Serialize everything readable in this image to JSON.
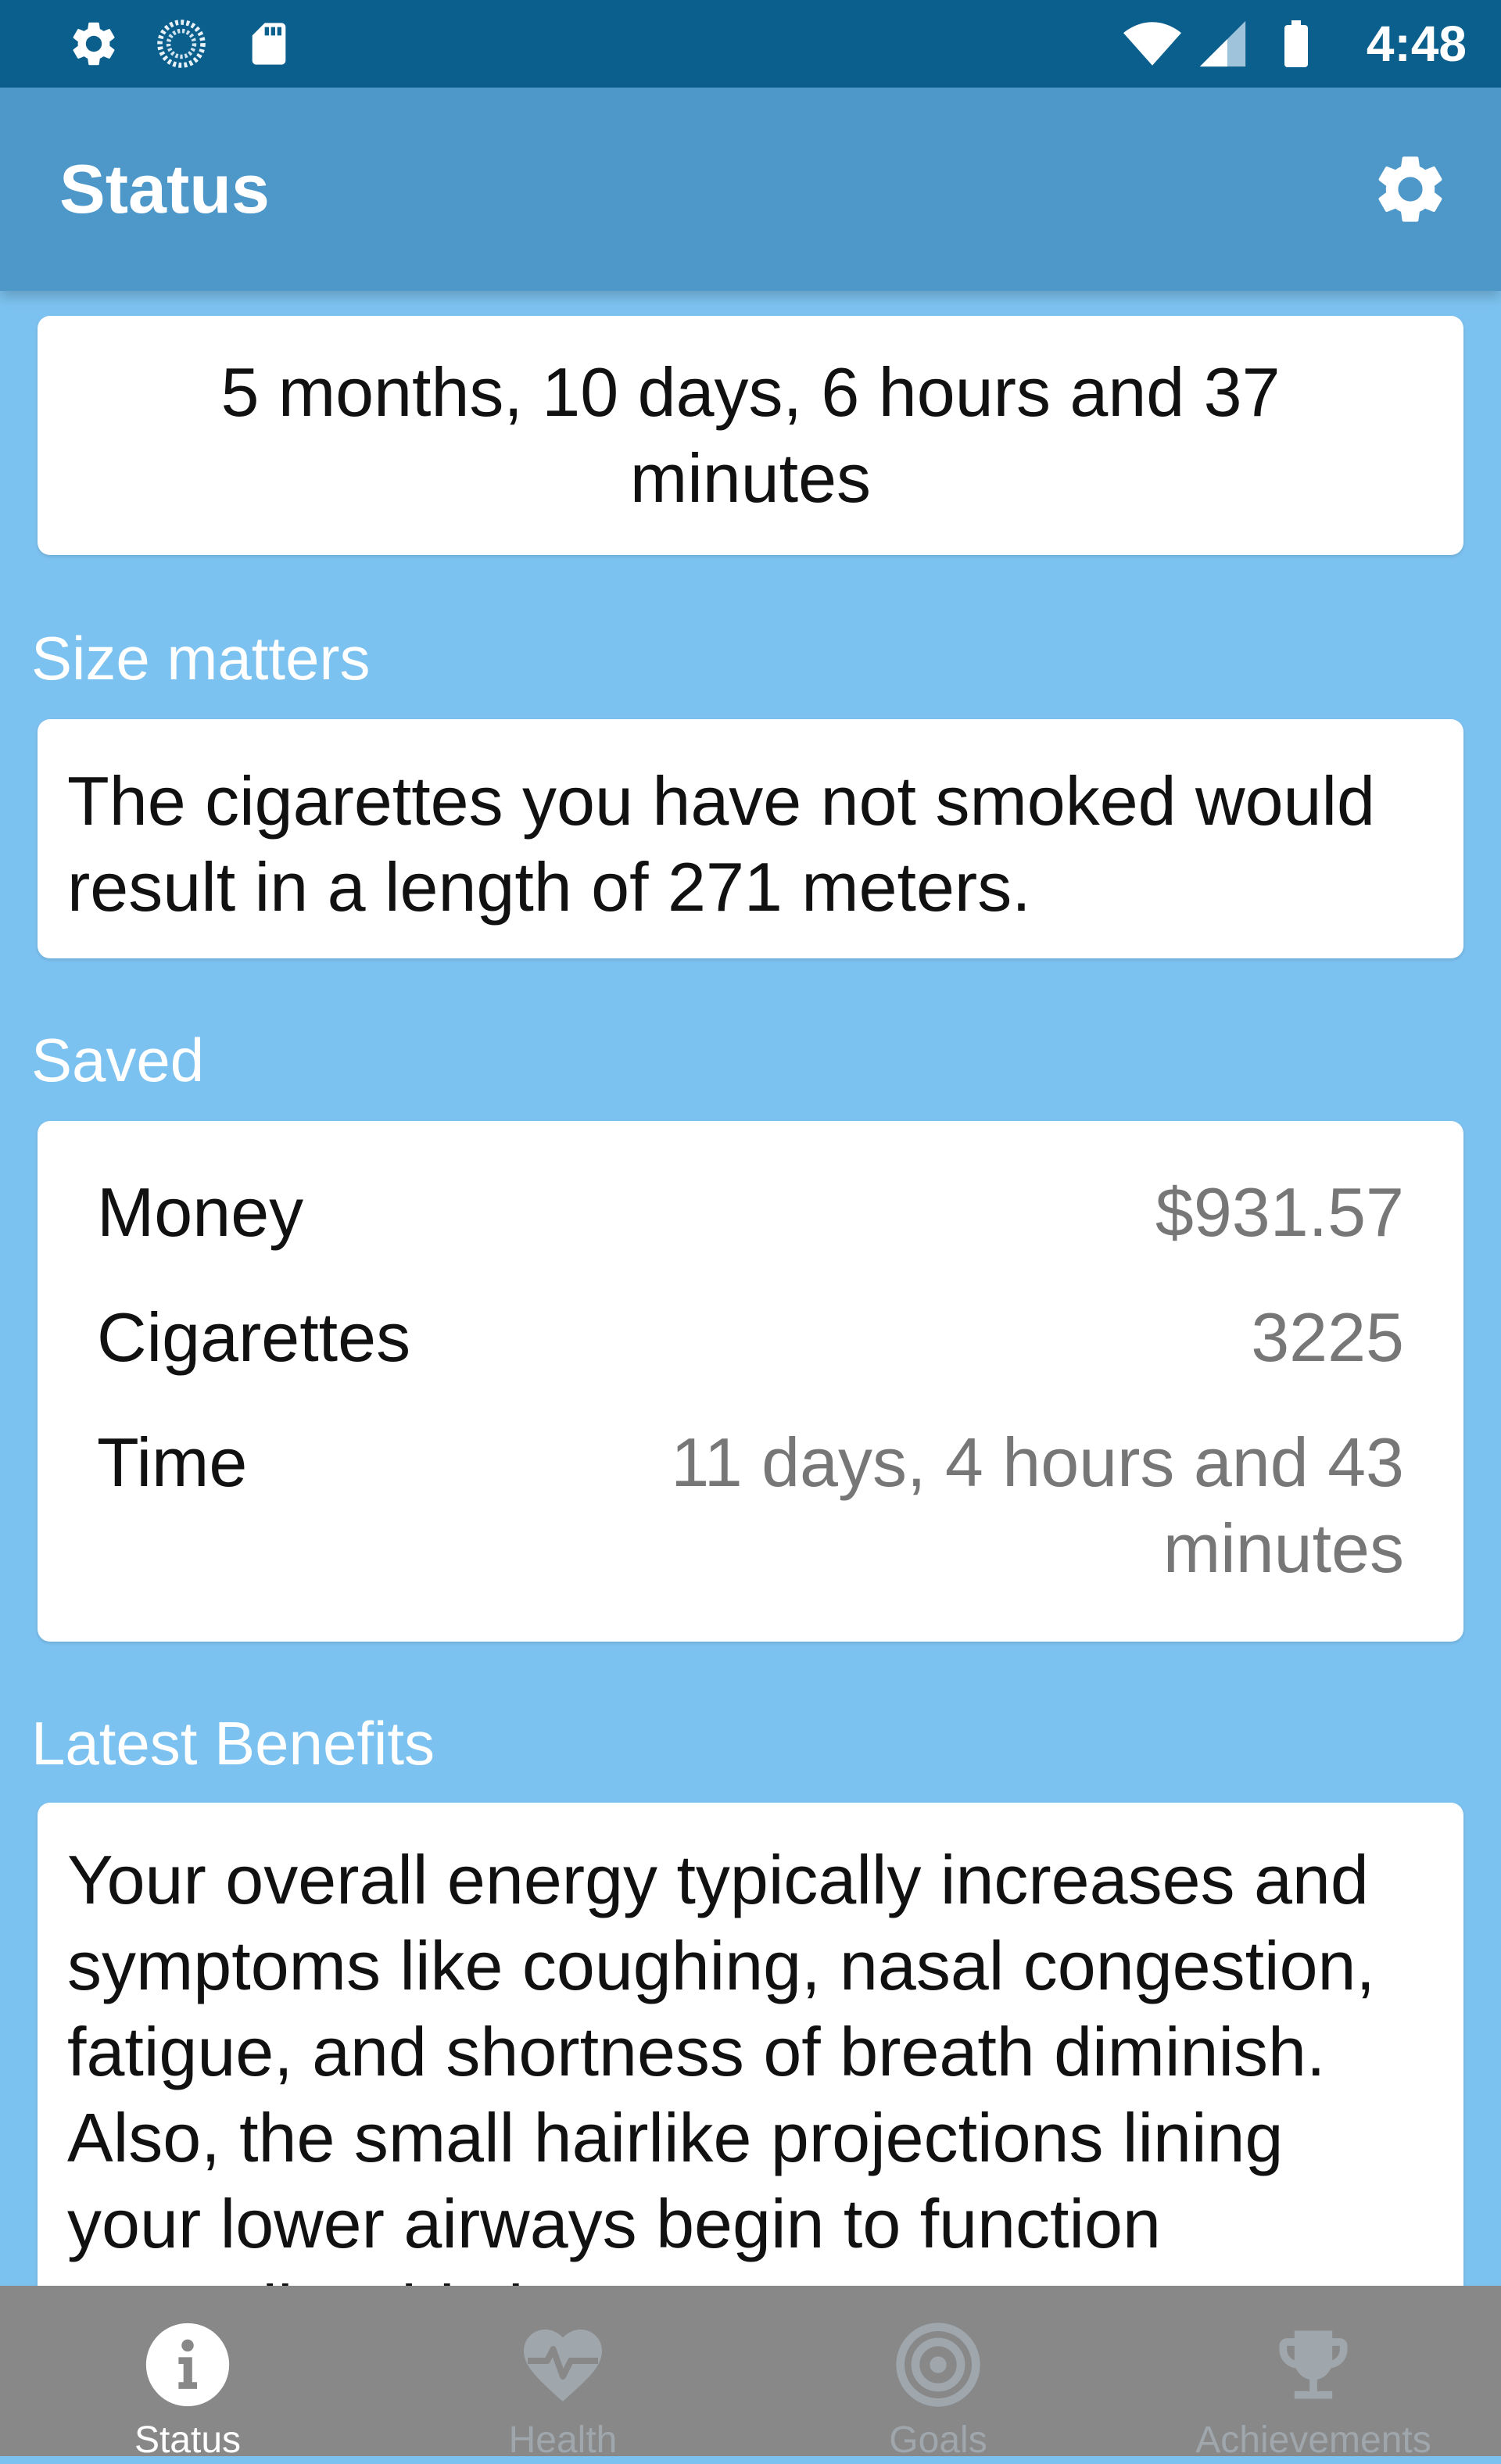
{
  "status_bar": {
    "time": "4:48",
    "icons": [
      "gear-icon",
      "sync-icon",
      "sd-card-icon",
      "wifi-icon",
      "signal-icon",
      "battery-icon"
    ]
  },
  "app_bar": {
    "title": "Status",
    "action_icon": "gear-icon"
  },
  "duration": {
    "text": "5 months, 10 days, 6 hours and 37 minutes"
  },
  "size_matters": {
    "title": "Size matters",
    "text": "The cigarettes you have not smoked would result in a length of 271 meters."
  },
  "saved": {
    "title": "Saved",
    "rows": [
      {
        "label": "Money",
        "value": "$931.57"
      },
      {
        "label": "Cigarettes",
        "value": "3225"
      },
      {
        "label": "Time",
        "value": "11 days, 4 hours and 43 minutes"
      }
    ]
  },
  "latest_benefits": {
    "title": "Latest Benefits",
    "text": "Your overall energy typically increases and symptoms like coughing, nasal congestion, fatigue, and shortness of breath diminish. Also, the small hairlike projections lining your lower airways begin to function normally. This improves"
  },
  "bottom_nav": {
    "items": [
      {
        "label": "Status",
        "icon": "info-icon",
        "active": true
      },
      {
        "label": "Health",
        "icon": "heart-pulse-icon",
        "active": false
      },
      {
        "label": "Goals",
        "icon": "target-icon",
        "active": false
      },
      {
        "label": "Achievements",
        "icon": "trophy-icon",
        "active": false
      }
    ]
  },
  "colors": {
    "status_bar": "#0b5f8d",
    "app_bar": "#4e97c9",
    "background": "#7cc2f0",
    "card": "#ffffff",
    "bottom_nav": "#888888",
    "nav_inactive": "#9fa7ad"
  }
}
